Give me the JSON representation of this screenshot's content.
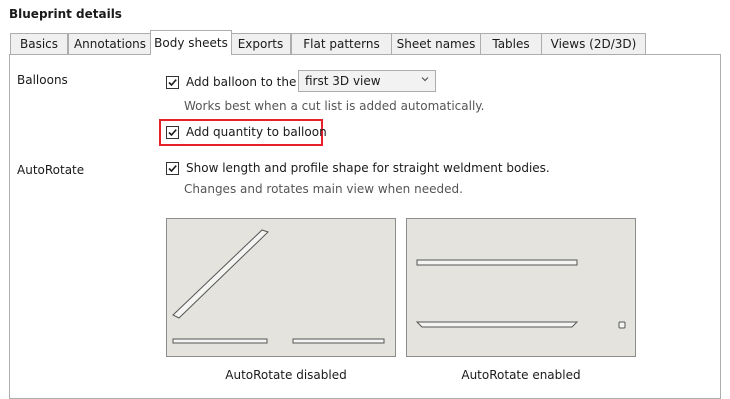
{
  "title": "Blueprint details",
  "tabs": [
    {
      "label": "Basics"
    },
    {
      "label": "Annotations"
    },
    {
      "label": "Body sheets"
    },
    {
      "label": "Exports"
    },
    {
      "label": "Flat patterns"
    },
    {
      "label": "Sheet names"
    },
    {
      "label": "Tables"
    },
    {
      "label": "Views (2D/3D)"
    }
  ],
  "active_tab": "Body sheets",
  "balloons": {
    "section_label": "Balloons",
    "add_balloon": {
      "label": "Add balloon to the",
      "checked": true
    },
    "view_select": {
      "value": "first 3D view"
    },
    "hint": "Works best when a cut list is added automatically.",
    "add_quantity": {
      "label": "Add quantity to balloon",
      "checked": true,
      "highlight_color": "#e8202a"
    }
  },
  "autorotate": {
    "section_label": "AutoRotate",
    "show_length": {
      "label": "Show length and profile shape for straight weldment bodies.",
      "checked": true
    },
    "hint": "Changes and rotates main view when needed.",
    "previews": [
      {
        "caption": "AutoRotate disabled"
      },
      {
        "caption": "AutoRotate enabled"
      }
    ]
  }
}
